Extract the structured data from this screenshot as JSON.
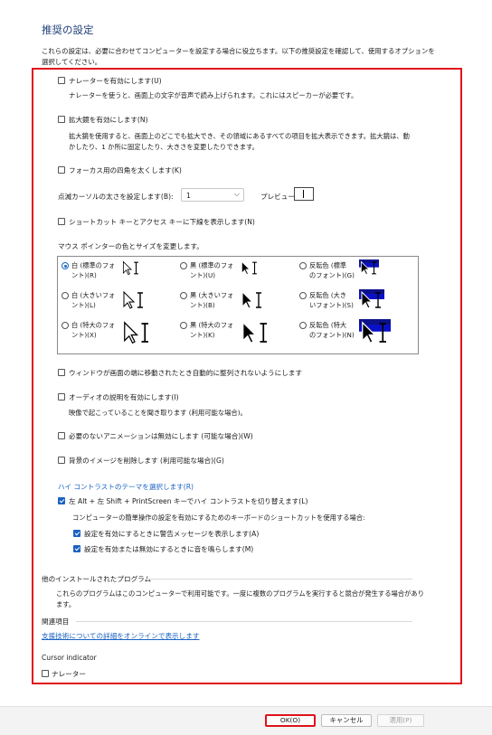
{
  "title": "推奨の設定",
  "intro": "これらの設定は、必要に合わせてコンピューターを設定する場合に役立ちます。以下の推奨設定を確認して、使用するオプションを選択してください。",
  "narrator": {
    "label": "ナレーターを有効にします(U)",
    "desc": "ナレーターを使うと、画面上の文字が音声で読み上げられます。これにはスピーカーが必要です。",
    "checked": false
  },
  "magnifier": {
    "label": "拡大鏡を有効にします(N)",
    "desc_line1": "拡大鏡を使用すると、画面上のどこでも拡大でき、その領域にあるすべての項目を拡大表示できます。拡大鏡は、動",
    "desc_line2": "かしたり、1 か所に固定したり、大きさを変更したりできます。",
    "checked": false
  },
  "focus_rect": {
    "label": "フォーカス用の四角を太くします(K)",
    "checked": false
  },
  "cursor_thickness": {
    "label": "点滅カーソルの太さを設定します(B):",
    "value": "1",
    "preview_label": "プレビュー:"
  },
  "underline_shortcuts": {
    "label": "ショートカット キーとアクセス キーに下線を表示します(N)",
    "checked": false
  },
  "pointer_section": {
    "label": "マウス ポインターの色とサイズを変更します。",
    "options": [
      {
        "line1": "白 (標準のフォ",
        "line2": "ント)(R)",
        "selected": true,
        "style": "white",
        "size": "standard"
      },
      {
        "line1": "黒 (標準のフォ",
        "line2": "ント)(U)",
        "selected": false,
        "style": "black",
        "size": "standard"
      },
      {
        "line1": "反転色 (標準",
        "line2": "のフォント)(G)",
        "selected": false,
        "style": "invert",
        "size": "standard"
      },
      {
        "line1": "白 (大きいフォ",
        "line2": "ント)(L)",
        "selected": false,
        "style": "white",
        "size": "large"
      },
      {
        "line1": "黒 (大きいフォ",
        "line2": "ント)(B)",
        "selected": false,
        "style": "black",
        "size": "large"
      },
      {
        "line1": "反転色 (大き",
        "line2": "いフォント)(S)",
        "selected": false,
        "style": "invert",
        "size": "large"
      },
      {
        "line1": "白 (特大のフォ",
        "line2": "ント)(X)",
        "selected": false,
        "style": "white",
        "size": "xlarge"
      },
      {
        "line1": "黒 (特大のフォ",
        "line2": "ント)(K)",
        "selected": false,
        "style": "black",
        "size": "xlarge"
      },
      {
        "line1": "反転色 (特大",
        "line2": "のフォント)(N)",
        "selected": false,
        "style": "invert",
        "size": "xlarge"
      }
    ]
  },
  "prevent_arrange": {
    "label": "ウィンドウが画面の端に移動されたとき自動的に整列されないようにします",
    "checked": false
  },
  "audio_description": {
    "label": "オーディオの説明を有効にします(I)",
    "desc": "映像で起こっていることを聞き取ります (利用可能な場合)。",
    "checked": false
  },
  "disable_animations": {
    "label": "必要のないアニメーションは無効にします (可能な場合)(W)",
    "checked": false
  },
  "remove_backgrounds": {
    "label": "背景のイメージを削除します (利用可能な場合)(G)",
    "checked": false
  },
  "high_contrast": {
    "link": "ハイ コントラストのテーマを選択します(R)",
    "toggle_label": "左 Alt + 左 Shift + PrintScreen キーでハイ コントラストを切り替えます(L)",
    "toggle_checked": true,
    "sub_desc": "コンピューターの簡単操作の設定を有効にするためのキーボードのショートカットを使用する場合:",
    "warn_label": "設定を有効にするときに警告メッセージを表示します(A)",
    "warn_checked": true,
    "sound_label": "設定を有効または無効にするときに音を鳴らします(M)",
    "sound_checked": true
  },
  "other_programs": {
    "heading": "他のインストールされたプログラム",
    "desc_line1": "これらのプログラムはこのコンピューターで利用可能です。一度に複数のプログラムを実行すると競合が発生する場合があり",
    "desc_line2": "ます。"
  },
  "related": {
    "heading": "関連項目",
    "link": "支援技術についての詳細をオンラインで表示します"
  },
  "cursor_indicator": {
    "heading": "Cursor indicator",
    "narrator_label": "ナレーター",
    "checked": false
  },
  "buttons": {
    "ok": "OK(O)",
    "cancel": "キャンセル",
    "apply": "適用(P)"
  },
  "colors": {
    "accent": "#1a63c2",
    "highlight_border": "#e0121b",
    "title": "#1f3f78"
  }
}
